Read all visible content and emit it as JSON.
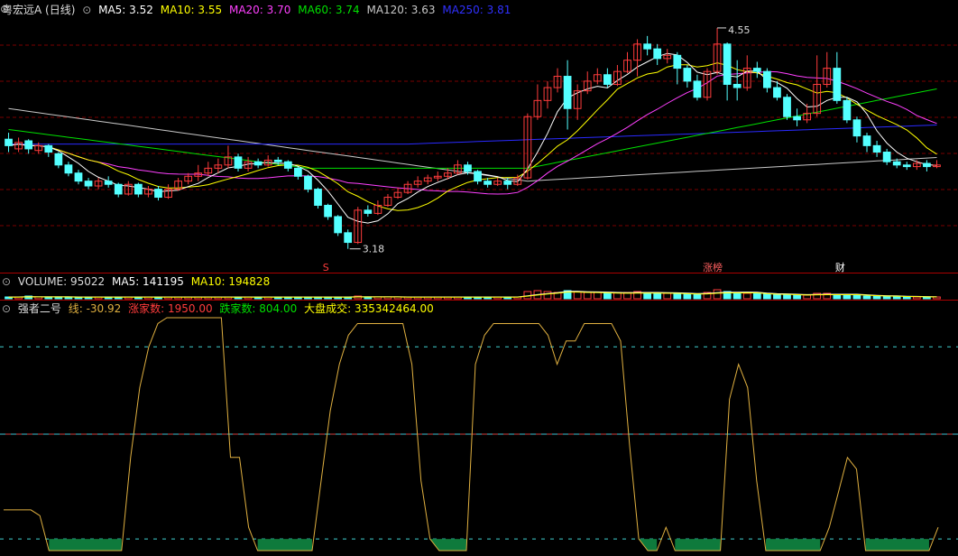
{
  "main_header": {
    "title": "粤宏远A (日线)",
    "ma5": "MA5: 3.52",
    "ma10": "MA10: 3.55",
    "ma20": "MA20: 3.70",
    "ma60": "MA60: 3.74",
    "ma120": "MA120: 3.63",
    "ma250": "MA250: 3.81"
  },
  "volume_header": {
    "volume": "VOLUME: 95022",
    "ma5": "MA5: 141195",
    "ma10": "MA10: 194828"
  },
  "indicator_header": {
    "name": "强者二号",
    "line": "线: -30.92",
    "up_count": "涨家数: 1950.00",
    "down_count": "跌家数: 804.00",
    "market_volume": "大盘成交: 335342464.00"
  },
  "markers": {
    "high_label": "4.55",
    "low_label": "3.18",
    "event_s": "S",
    "event_zhangbang": "涨榜",
    "event_cai": "财"
  },
  "colors": {
    "up": "#ff3c3c",
    "down": "#54ffff",
    "ma5": "#ffffff",
    "ma10": "#ffff00",
    "ma20": "#ff40ff",
    "ma60": "#00e000",
    "ma120": "#c8c8c8",
    "ma250": "#2a2aff",
    "indicator_line": "#e0b040",
    "indicator_fill": "#0e7a3c",
    "guide_upper": "#40d0d0",
    "guide_mid_cyan": "#40c0d0",
    "guide_mid_red": "#d04040",
    "guide_lower": "#40d0d0"
  },
  "chart_data": [
    {
      "type": "candlestick",
      "title": "粤宏远A (日线)",
      "price_range": [
        3.1,
        4.6
      ],
      "high": 4.55,
      "low": 3.18,
      "candles": [
        [
          3.86,
          3.82,
          3.9,
          3.78
        ],
        [
          3.8,
          3.84,
          3.87,
          3.78
        ],
        [
          3.85,
          3.8,
          3.86,
          3.77
        ],
        [
          3.79,
          3.82,
          3.84,
          3.77
        ],
        [
          3.82,
          3.78,
          3.83,
          3.75
        ],
        [
          3.77,
          3.7,
          3.78,
          3.68
        ],
        [
          3.7,
          3.65,
          3.72,
          3.63
        ],
        [
          3.65,
          3.6,
          3.67,
          3.58
        ],
        [
          3.6,
          3.57,
          3.62,
          3.55
        ],
        [
          3.57,
          3.6,
          3.62,
          3.55
        ],
        [
          3.6,
          3.58,
          3.63,
          3.56
        ],
        [
          3.58,
          3.52,
          3.59,
          3.5
        ],
        [
          3.52,
          3.58,
          3.6,
          3.51
        ],
        [
          3.58,
          3.52,
          3.59,
          3.5
        ],
        [
          3.52,
          3.55,
          3.57,
          3.5
        ],
        [
          3.55,
          3.5,
          3.57,
          3.48
        ],
        [
          3.5,
          3.55,
          3.58,
          3.49
        ],
        [
          3.55,
          3.6,
          3.62,
          3.54
        ],
        [
          3.6,
          3.63,
          3.65,
          3.58
        ],
        [
          3.63,
          3.65,
          3.7,
          3.6
        ],
        [
          3.65,
          3.68,
          3.72,
          3.63
        ],
        [
          3.68,
          3.7,
          3.74,
          3.65
        ],
        [
          3.7,
          3.75,
          3.82,
          3.68
        ],
        [
          3.75,
          3.68,
          3.77,
          3.66
        ],
        [
          3.68,
          3.72,
          3.75,
          3.66
        ],
        [
          3.72,
          3.7,
          3.74,
          3.68
        ],
        [
          3.7,
          3.73,
          3.76,
          3.69
        ],
        [
          3.73,
          3.72,
          3.75,
          3.7
        ],
        [
          3.72,
          3.68,
          3.73,
          3.66
        ],
        [
          3.68,
          3.63,
          3.69,
          3.61
        ],
        [
          3.63,
          3.55,
          3.64,
          3.53
        ],
        [
          3.55,
          3.45,
          3.56,
          3.43
        ],
        [
          3.45,
          3.38,
          3.46,
          3.36
        ],
        [
          3.38,
          3.28,
          3.39,
          3.26
        ],
        [
          3.28,
          3.22,
          3.3,
          3.18
        ],
        [
          3.22,
          3.42,
          3.44,
          3.21
        ],
        [
          3.42,
          3.4,
          3.45,
          3.38
        ],
        [
          3.4,
          3.45,
          3.48,
          3.39
        ],
        [
          3.45,
          3.5,
          3.52,
          3.44
        ],
        [
          3.5,
          3.53,
          3.56,
          3.49
        ],
        [
          3.53,
          3.58,
          3.6,
          3.52
        ],
        [
          3.58,
          3.6,
          3.63,
          3.56
        ],
        [
          3.6,
          3.62,
          3.64,
          3.58
        ],
        [
          3.62,
          3.63,
          3.66,
          3.6
        ],
        [
          3.63,
          3.65,
          3.68,
          3.61
        ],
        [
          3.65,
          3.7,
          3.73,
          3.64
        ],
        [
          3.7,
          3.66,
          3.72,
          3.64
        ],
        [
          3.66,
          3.6,
          3.67,
          3.58
        ],
        [
          3.6,
          3.58,
          3.62,
          3.56
        ],
        [
          3.58,
          3.6,
          3.62,
          3.57
        ],
        [
          3.6,
          3.58,
          3.62,
          3.55
        ],
        [
          3.58,
          3.62,
          3.64,
          3.57
        ],
        [
          3.62,
          4.0,
          4.02,
          3.61
        ],
        [
          4.0,
          4.1,
          4.2,
          3.98
        ],
        [
          4.1,
          4.18,
          4.22,
          4.05
        ],
        [
          4.18,
          4.25,
          4.3,
          4.15
        ],
        [
          4.25,
          4.05,
          4.35,
          3.92
        ],
        [
          4.05,
          4.16,
          4.2,
          3.98
        ],
        [
          4.16,
          4.22,
          4.28,
          4.14
        ],
        [
          4.22,
          4.26,
          4.3,
          4.2
        ],
        [
          4.26,
          4.2,
          4.3,
          4.18
        ],
        [
          4.2,
          4.28,
          4.32,
          4.19
        ],
        [
          4.28,
          4.35,
          4.4,
          4.27
        ],
        [
          4.35,
          4.45,
          4.48,
          4.25
        ],
        [
          4.45,
          4.42,
          4.5,
          4.38
        ],
        [
          4.42,
          4.36,
          4.45,
          4.32
        ],
        [
          4.36,
          4.38,
          4.42,
          4.33
        ],
        [
          4.38,
          4.3,
          4.4,
          4.2
        ],
        [
          4.3,
          4.22,
          4.32,
          4.18
        ],
        [
          4.22,
          4.12,
          4.26,
          4.1
        ],
        [
          4.12,
          4.28,
          4.3,
          4.1
        ],
        [
          4.28,
          4.45,
          4.55,
          4.26
        ],
        [
          4.45,
          4.2,
          4.46,
          4.1
        ],
        [
          4.2,
          4.18,
          4.35,
          4.1
        ],
        [
          4.18,
          4.3,
          4.38,
          4.16
        ],
        [
          4.3,
          4.28,
          4.34,
          4.24
        ],
        [
          4.28,
          4.18,
          4.3,
          4.15
        ],
        [
          4.18,
          4.12,
          4.22,
          4.1
        ],
        [
          4.12,
          4.0,
          4.14,
          3.98
        ],
        [
          4.0,
          3.98,
          4.05,
          3.94
        ],
        [
          3.98,
          4.02,
          4.08,
          3.96
        ],
        [
          4.02,
          4.2,
          4.38,
          4.0
        ],
        [
          4.2,
          4.3,
          4.4,
          4.18
        ],
        [
          4.3,
          4.1,
          4.4,
          4.08
        ],
        [
          4.1,
          3.98,
          4.12,
          3.96
        ],
        [
          3.98,
          3.88,
          4.0,
          3.84
        ],
        [
          3.88,
          3.82,
          3.9,
          3.78
        ],
        [
          3.82,
          3.78,
          3.85,
          3.75
        ],
        [
          3.78,
          3.72,
          3.8,
          3.7
        ],
        [
          3.72,
          3.7,
          3.74,
          3.68
        ],
        [
          3.7,
          3.69,
          3.72,
          3.67
        ],
        [
          3.69,
          3.71,
          3.73,
          3.67
        ],
        [
          3.71,
          3.69,
          3.73,
          3.66
        ],
        [
          3.69,
          3.7,
          3.73,
          3.68
        ]
      ]
    },
    {
      "type": "bar",
      "title": "VOLUME",
      "values": [
        2,
        2,
        3,
        2,
        2,
        2,
        2,
        2,
        2,
        2,
        2,
        2,
        2,
        2,
        2,
        2,
        2,
        2,
        2,
        2,
        2,
        2,
        2,
        2,
        2,
        2,
        2,
        2,
        2,
        2,
        2,
        2,
        2,
        2,
        2,
        3,
        2,
        2,
        2,
        2,
        2,
        2,
        2,
        2,
        2,
        2,
        2,
        2,
        2,
        2,
        2,
        2,
        8,
        9,
        8,
        7,
        9,
        8,
        7,
        7,
        6,
        7,
        7,
        8,
        7,
        6,
        6,
        6,
        6,
        5,
        7,
        10,
        8,
        6,
        6,
        6,
        5,
        5,
        5,
        4,
        4,
        6,
        6,
        5,
        4,
        4,
        3,
        3,
        3,
        3,
        2,
        2,
        2,
        2
      ]
    },
    {
      "type": "line",
      "title": "强者二号",
      "ylim": [
        -100,
        100
      ],
      "guides": [
        75,
        0,
        -90
      ],
      "values": [
        -65,
        -65,
        -65,
        -65,
        -70,
        -100,
        -100,
        -100,
        -100,
        -100,
        -100,
        -100,
        -100,
        -100,
        -20,
        40,
        75,
        95,
        100,
        100,
        100,
        100,
        100,
        100,
        100,
        -20,
        -20,
        -80,
        -100,
        -100,
        -100,
        -100,
        -100,
        -100,
        -100,
        -40,
        20,
        60,
        85,
        95,
        95,
        95,
        95,
        95,
        95,
        60,
        -40,
        -90,
        -100,
        -100,
        -100,
        -100,
        60,
        85,
        95,
        95,
        95,
        95,
        95,
        95,
        85,
        60,
        80,
        80,
        95,
        95,
        95,
        95,
        80,
        -10,
        -90,
        -100,
        -100,
        -80,
        -100,
        -100,
        -100,
        -100,
        -100,
        -100,
        30,
        60,
        40,
        -40,
        -100,
        -100,
        -100,
        -100,
        -100,
        -100,
        -100,
        -80,
        -50,
        -20,
        -30,
        -100,
        -100,
        -100,
        -100,
        -100,
        -100,
        -100,
        -100,
        -80
      ]
    }
  ]
}
